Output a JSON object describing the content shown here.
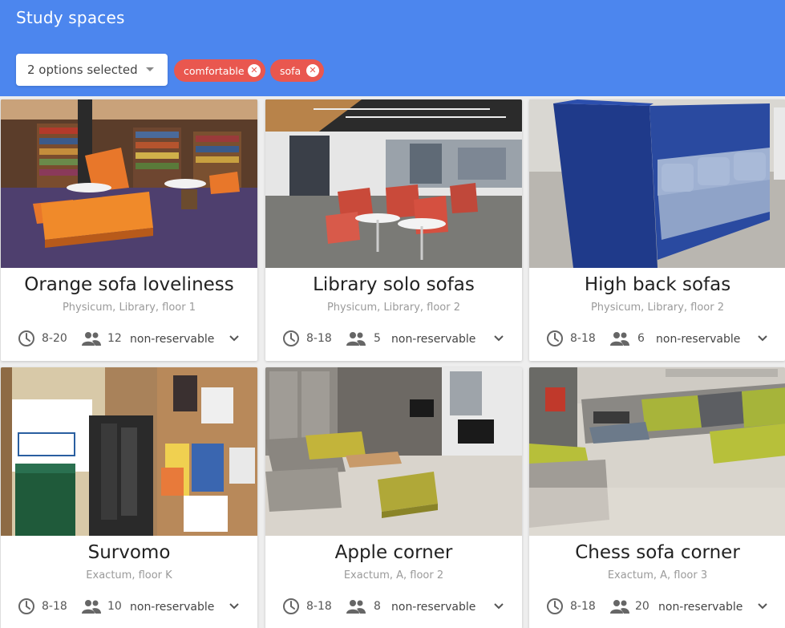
{
  "header": {
    "title": "Study spaces",
    "filter_select": {
      "value": "2 options selected"
    },
    "chips": [
      {
        "label": "comfortable"
      },
      {
        "label": "sofa"
      }
    ],
    "accent_color": "#4c86ee",
    "chip_color": "#e9574f"
  },
  "cards": [
    {
      "title": "Orange sofa loveliness",
      "location": "Physicum, Library, floor 1",
      "hours": "8-20",
      "capacity": "12",
      "reservation": "non-reservable"
    },
    {
      "title": "Library solo sofas",
      "location": "Physicum, Library, floor 2",
      "hours": "8-18",
      "capacity": "5",
      "reservation": "non-reservable"
    },
    {
      "title": "High back sofas",
      "location": "Physicum, Library, floor 2",
      "hours": "8-18",
      "capacity": "6",
      "reservation": "non-reservable"
    },
    {
      "title": "Survomo",
      "location": "Exactum, floor K",
      "hours": "8-18",
      "capacity": "10",
      "reservation": "non-reservable"
    },
    {
      "title": "Apple corner",
      "location": "Exactum, A, floor 2",
      "hours": "8-18",
      "capacity": "8",
      "reservation": "non-reservable"
    },
    {
      "title": "Chess sofa corner",
      "location": "Exactum, A, floor 3",
      "hours": "8-18",
      "capacity": "20",
      "reservation": "non-reservable"
    }
  ],
  "icons": {
    "hours": "clock-icon",
    "capacity": "people-icon",
    "expand": "chevron-down-icon"
  }
}
